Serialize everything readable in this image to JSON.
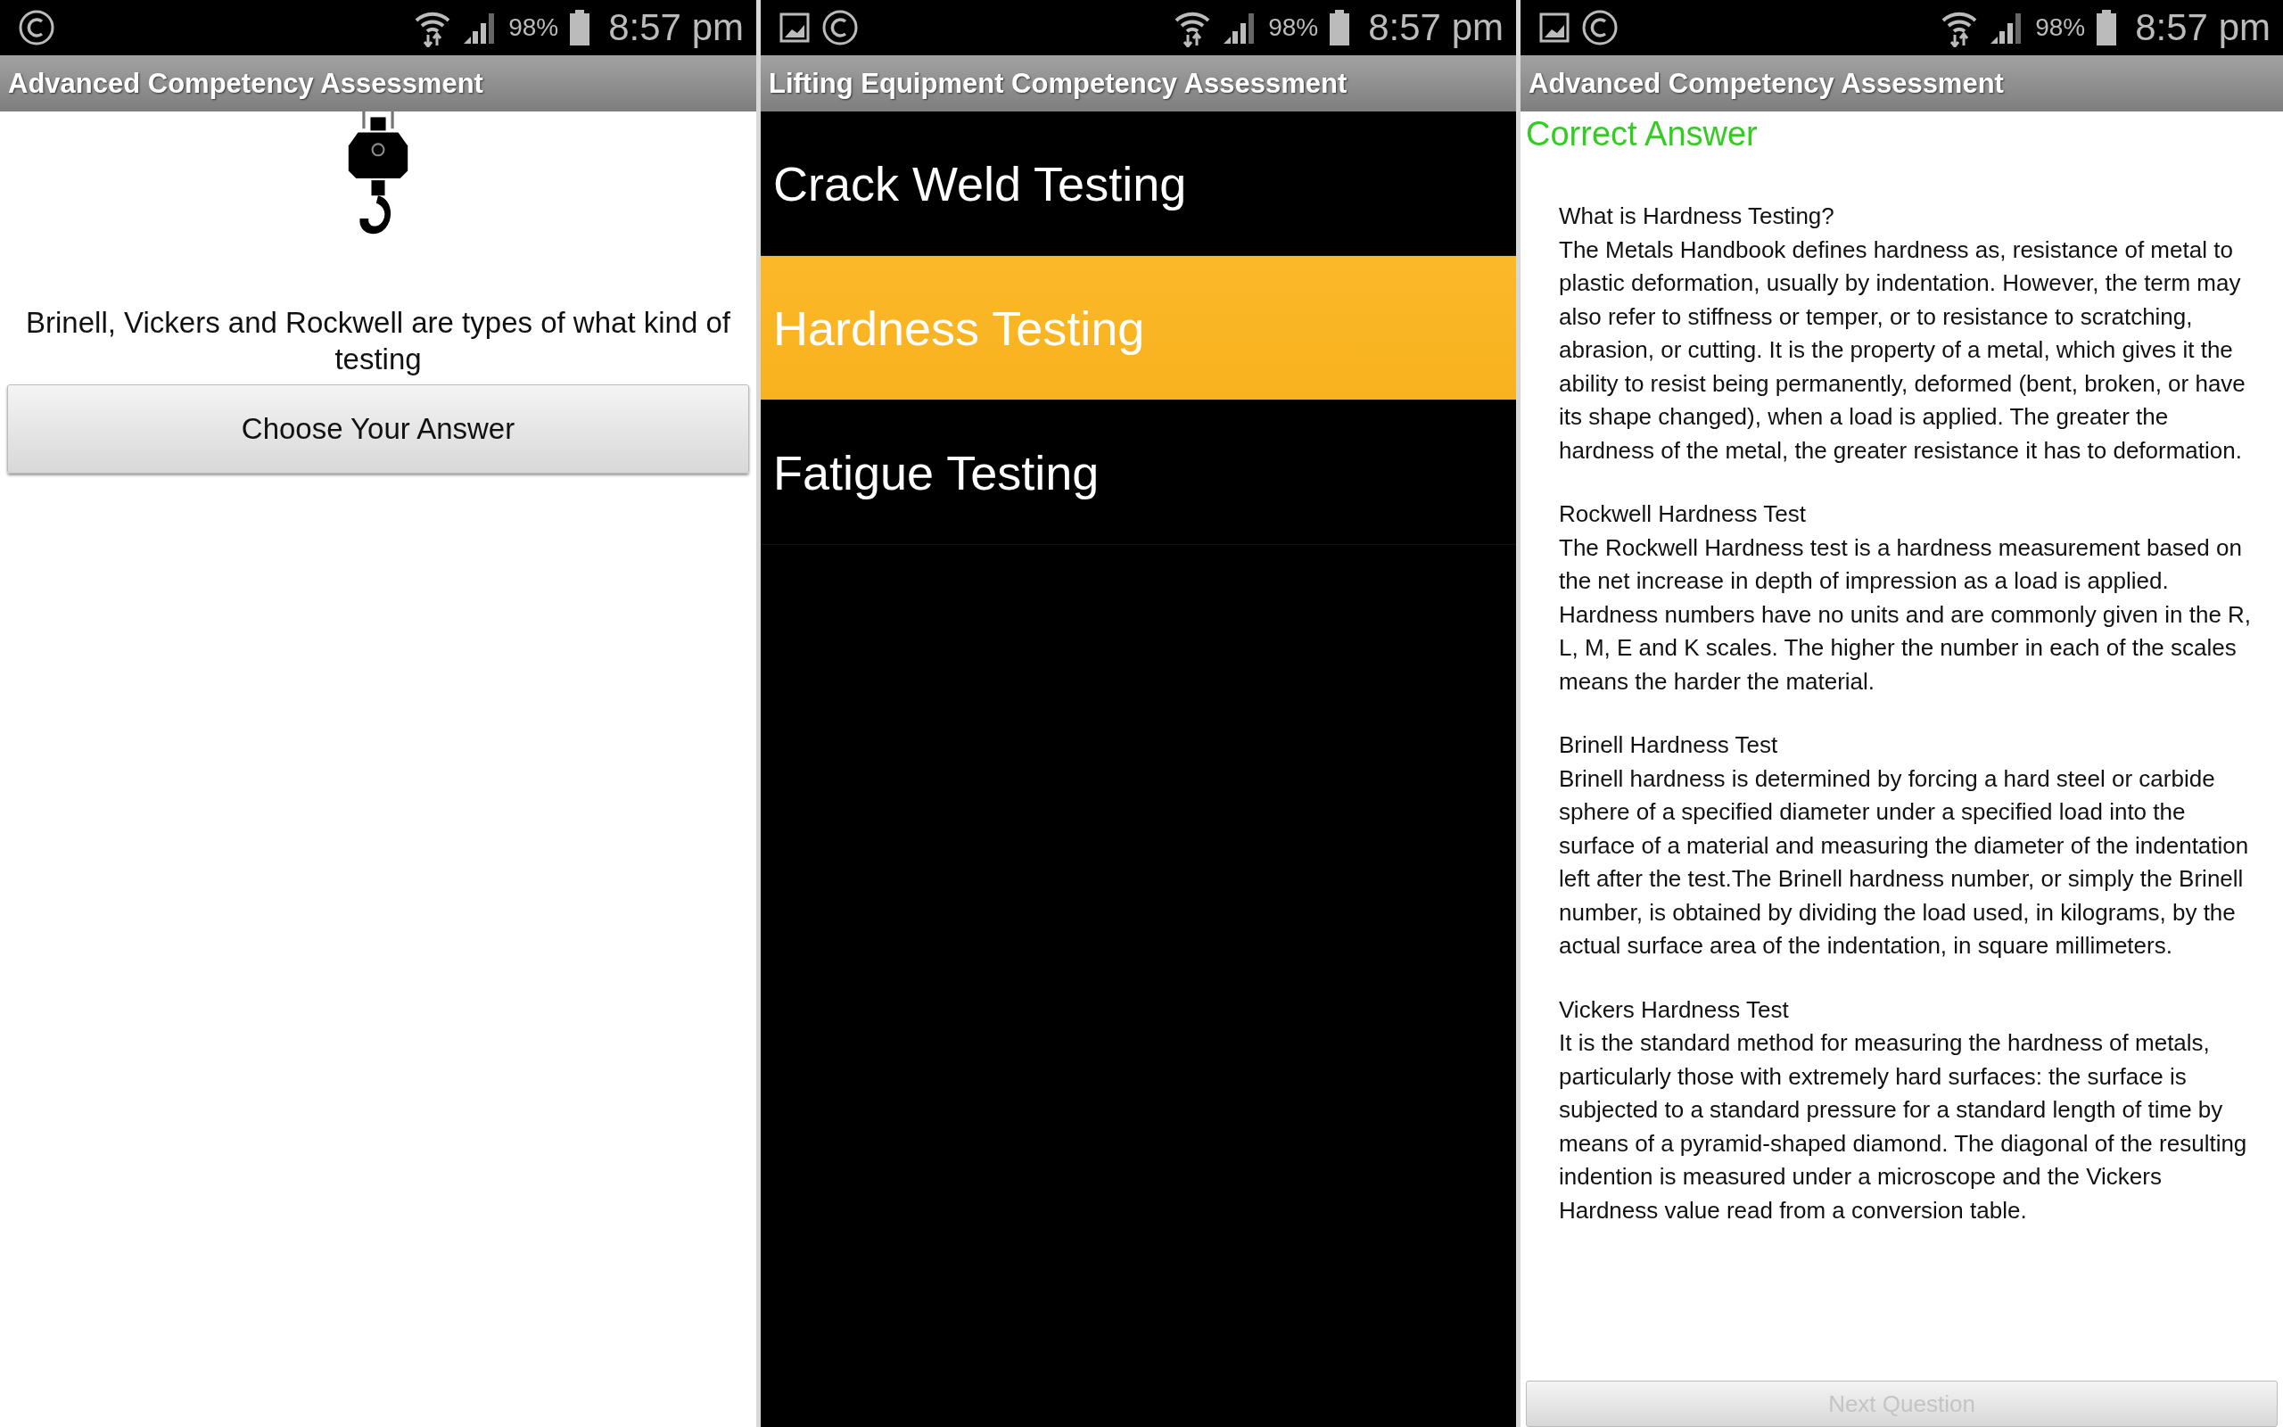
{
  "panels": [
    {
      "kind": "question",
      "status_bar": {
        "photo_notification": false,
        "battery": "98%",
        "time": "8:57 pm"
      },
      "title": "Advanced Competency Assessment",
      "question": "Brinell, Vickers and Rockwell are types of what kind of testing",
      "button": "Choose Your Answer"
    },
    {
      "kind": "choices",
      "status_bar": {
        "photo_notification": true,
        "battery": "98%",
        "time": "8:57 pm"
      },
      "title": "Lifting Equipment Competency Assessment",
      "options": [
        {
          "label": "Crack Weld Testing",
          "selected": false
        },
        {
          "label": "Hardness Testing",
          "selected": true
        },
        {
          "label": "Fatigue Testing",
          "selected": false
        }
      ]
    },
    {
      "kind": "answer",
      "status_bar": {
        "photo_notification": true,
        "battery": "98%",
        "time": "8:57 pm"
      },
      "title": "Advanced Competency Assessment",
      "result": "Correct Answer",
      "sections": [
        {
          "heading": "What is Hardness Testing?",
          "body": "The Metals Handbook defines hardness as, resistance of metal to plastic deformation, usually by indentation. However, the term may also refer to stiffness or temper, or to resistance to scratching, abrasion, or cutting. It is the property of a metal, which gives it the ability to resist being permanently, deformed (bent, broken, or have its shape changed), when a load is applied. The greater the hardness of the metal, the greater resistance it has to deformation."
        },
        {
          "heading": "Rockwell Hardness Test",
          "body": "The Rockwell Hardness test is a hardness measurement based on the net increase in depth of impression as a load is applied. Hardness numbers have no units and are commonly given in the R, L, M, E and K scales. The higher the number in each of the scales means the harder the material."
        },
        {
          "heading": "Brinell Hardness Test",
          "body": "Brinell hardness is determined by forcing a hard steel or carbide sphere of a specified diameter under a specified load into the surface of a material and measuring the diameter of the indentation left after the test.The Brinell hardness number, or simply the Brinell number, is obtained by dividing the load used, in kilograms, by the actual surface area of the indentation, in square millimeters."
        },
        {
          "heading": "Vickers Hardness Test",
          "body": "It is the standard method for measuring the hardness of metals, particularly those with extremely hard surfaces: the surface is subjected to a standard pressure for a standard length of time by means of a pyramid-shaped diamond. The diagonal of the resulting indention is measured under a microscope and the Vickers Hardness value read from a conversion table."
        }
      ],
      "button": "Next Question"
    }
  ]
}
